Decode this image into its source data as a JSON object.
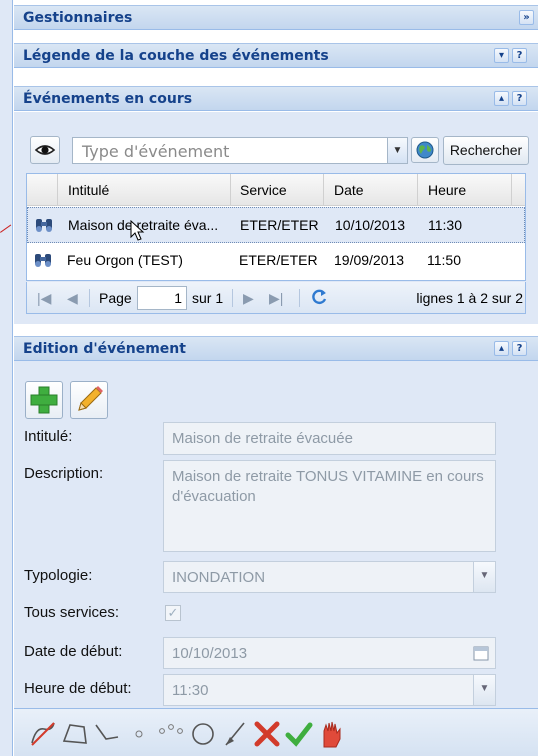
{
  "panels": {
    "gestionnaires": {
      "title": "Gestionnaires",
      "tool": "»"
    },
    "legende": {
      "title": "Légende de la couche des événements",
      "tools": [
        "▾",
        "?"
      ]
    },
    "evenements": {
      "title": "Événements en cours",
      "tools": [
        "▴",
        "?"
      ]
    },
    "edition": {
      "title": "Edition d'événement",
      "tools": [
        "▴",
        "?"
      ]
    }
  },
  "search": {
    "placeholder": "Type d'événement",
    "button_label": "Rechercher"
  },
  "grid": {
    "columns": [
      "Intitulé",
      "Service",
      "Date",
      "Heure"
    ],
    "rows": [
      {
        "intitule": "Maison de retraite éva...",
        "service": "ETER/ETER",
        "date": "10/10/2013",
        "heure": "11:30"
      },
      {
        "intitule": "Feu Orgon (TEST)",
        "service": "ETER/ETER",
        "date": "19/09/2013",
        "heure": "11:50"
      }
    ]
  },
  "paging": {
    "page_label": "Page",
    "current_page": "1",
    "of_label": "sur 1",
    "summary": "lignes 1 à 2 sur 2"
  },
  "form": {
    "intitule_label": "Intitulé:",
    "intitule_value": "Maison de retraite évacuée",
    "description_label": "Description:",
    "description_value": "Maison de retraite TONUS VITAMINE en cours d'évacuation",
    "typologie_label": "Typologie:",
    "typologie_value": "INONDATION",
    "tous_services_label": "Tous services:",
    "tous_services_checked": true,
    "date_label": "Date de début:",
    "date_value": "10/10/2013",
    "heure_label": "Heure de début:",
    "heure_value": "11:30"
  },
  "colors": {
    "header_text": "#15428b",
    "panel_bg": "#dfe8f6",
    "border": "#99bbe8",
    "selected_row": "#dfe8f6",
    "delete_red": "#d23b2b",
    "validate_green": "#3fae3f"
  },
  "icons": {
    "eye": "eye-icon",
    "globe": "globe-icon",
    "row": "binoculars-icon",
    "add": "plus-icon",
    "edit": "pencil-icon",
    "refresh": "refresh-icon",
    "draw_tools": [
      "freehand-icon",
      "polygon-icon",
      "line-icon",
      "point-icon",
      "multipoint-icon",
      "circle-icon",
      "curve-icon",
      "delete-icon",
      "validate-icon",
      "stop-hand-icon"
    ]
  }
}
